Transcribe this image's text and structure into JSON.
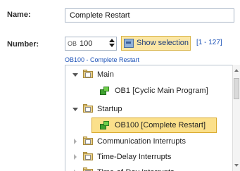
{
  "form": {
    "name_label": "Name:",
    "name_value": "Complete Restart",
    "number_label": "Number:",
    "number_prefix": "OB",
    "number_value": "100",
    "show_selection_label": "Show selection",
    "range_text": "[1 - 127]",
    "path_text": "OB100 - Complete Restart"
  },
  "tree": {
    "main": "Main",
    "ob1": "OB1 [Cyclic Main Program]",
    "startup": "Startup",
    "ob100": "OB100 [Complete Restart]",
    "comm": "Communication Interrupts",
    "delay": "Time-Delay Interrupts",
    "tod": "Time-of-Day Interrupts"
  },
  "colors": {
    "selection": "#fbe08b",
    "link": "#1d53b8"
  },
  "icons": {
    "folder": "folder-icon",
    "block": "organization-block-icon"
  }
}
